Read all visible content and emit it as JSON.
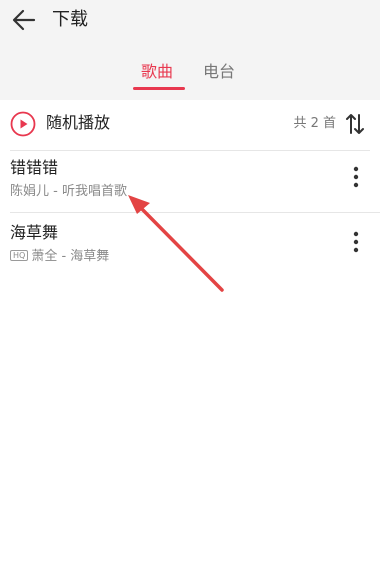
{
  "header": {
    "title": "下载"
  },
  "tabs": [
    {
      "label": "歌曲",
      "active": true
    },
    {
      "label": "电台",
      "active": false
    }
  ],
  "shuffle": {
    "label": "随机播放",
    "count": "共 2 首"
  },
  "songs": [
    {
      "title": "错错错",
      "subtitle": "陈娟儿 - 听我唱首歌",
      "quality_badge": ""
    },
    {
      "title": "海草舞",
      "subtitle": "萧全 - 海草舞",
      "quality_badge": "HQ"
    }
  ],
  "colors": {
    "accent": "#e8384f",
    "annotation_arrow": "#e34444"
  },
  "icons": {
    "back": "back-arrow-icon",
    "play": "play-circle-icon",
    "sort": "sort-icon",
    "more": "more-vertical-icon"
  }
}
